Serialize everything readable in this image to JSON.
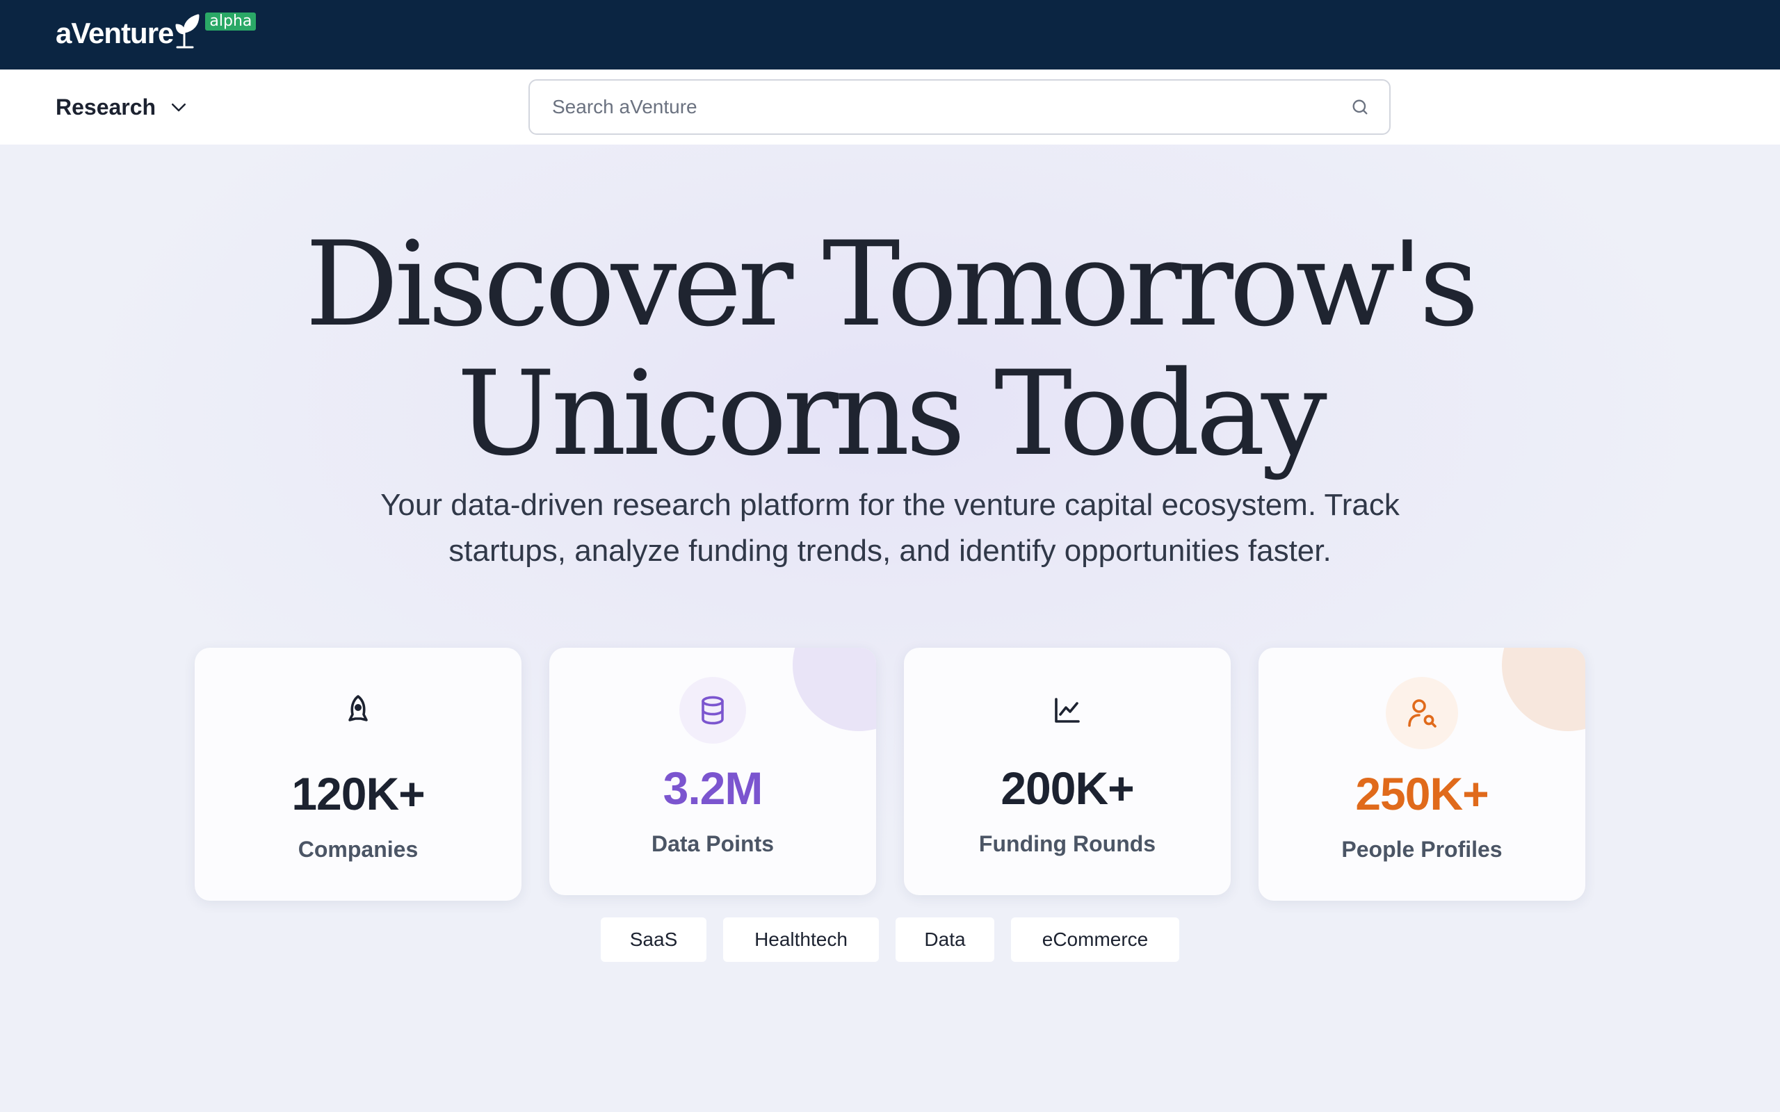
{
  "brand": {
    "name": "aVenture",
    "badge": "alpha"
  },
  "nav": {
    "research_label": "Research"
  },
  "search": {
    "placeholder": "Search aVenture",
    "value": ""
  },
  "hero": {
    "headline_line1": "Discover Tomorrow's",
    "headline_line2": "Unicorns Today",
    "subtitle_line1": "Your data-driven research platform for the venture capital ecosystem. Track",
    "subtitle_line2": "startups, analyze funding trends, and identify opportunities faster."
  },
  "stats": [
    {
      "value": "120K+",
      "label": "Companies",
      "icon": "rocket-icon",
      "color": "#1c2230"
    },
    {
      "value": "3.2M",
      "label": "Data Points",
      "icon": "database-icon",
      "color": "#7b55cf"
    },
    {
      "value": "200K+",
      "label": "Funding Rounds",
      "icon": "chart-line-icon",
      "color": "#1c2230"
    },
    {
      "value": "250K+",
      "label": "People Profiles",
      "icon": "user-search-icon",
      "color": "#e06a1b"
    }
  ],
  "tags": [
    "SaaS",
    "Healthtech",
    "Data",
    "eCommerce"
  ],
  "colors": {
    "topbar": "#0b2542",
    "badge": "#2aa866",
    "purple_accent": "#7b55cf",
    "orange_accent": "#e06a1b"
  }
}
